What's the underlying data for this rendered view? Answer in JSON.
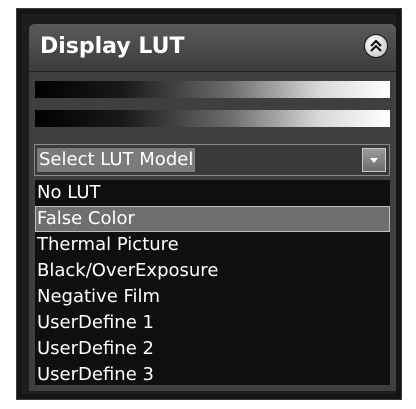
{
  "panel": {
    "title": "Display LUT",
    "collapse_icon": "double-chevron-up-icon"
  },
  "lut_model_select": {
    "value": "Select LUT Model",
    "arrow_icon": "chevron-down-icon"
  },
  "lut_list": {
    "items": [
      {
        "label": "No LUT",
        "selected": false
      },
      {
        "label": "False Color",
        "selected": true
      },
      {
        "label": "Thermal Picture",
        "selected": false
      },
      {
        "label": "Black/OverExposure",
        "selected": false
      },
      {
        "label": "Negative Film",
        "selected": false
      },
      {
        "label": "UserDefine 1",
        "selected": false
      },
      {
        "label": "UserDefine 2",
        "selected": false
      },
      {
        "label": "UserDefine 3",
        "selected": false
      }
    ]
  },
  "colors": {
    "background": "#151515",
    "panel": "#3f3f3f",
    "selection": "#6f6f6f",
    "text": "#ffffff"
  }
}
